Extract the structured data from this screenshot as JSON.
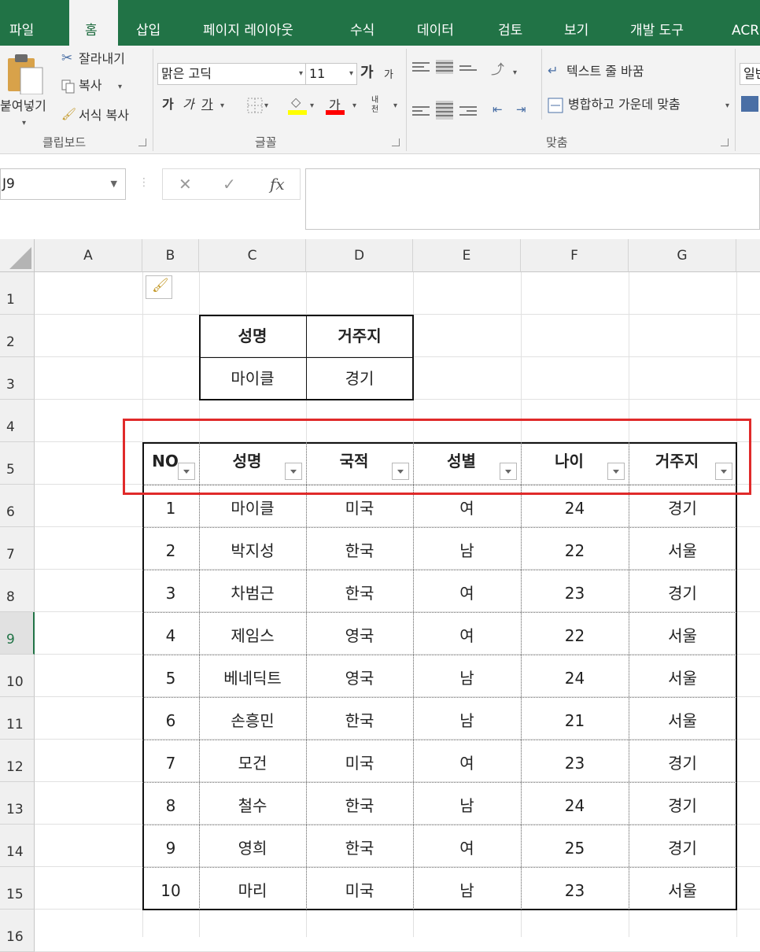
{
  "tabs": [
    "파일",
    "홈",
    "삽입",
    "페이지 레이아웃",
    "수식",
    "데이터",
    "검토",
    "보기",
    "개발 도구",
    "ACR"
  ],
  "active_tab": "홈",
  "clipboard": {
    "cut": "잘라내기",
    "copy": "복사",
    "paste": "붙여넣기",
    "format_painter": "서식 복사",
    "group": "클립보드"
  },
  "font": {
    "name": "맑은 고딕",
    "size": "11",
    "grow": "가",
    "shrink": "가",
    "bold": "가",
    "italic": "가",
    "underline": "가",
    "color_letter": "가",
    "phonetic": "내천",
    "group": "글꼴"
  },
  "alignment": {
    "wrap_text": "텍스트 줄 바꿈",
    "merge_center": "병합하고 가운데 맞춤",
    "group": "맞춤"
  },
  "number_format": "일반",
  "formula_bar": {
    "name_box": "J9",
    "cancel": "✕",
    "enter": "✓",
    "fx": "fx",
    "value": ""
  },
  "columns": [
    "A",
    "B",
    "C",
    "D",
    "E",
    "F",
    "G"
  ],
  "rows": [
    "1",
    "2",
    "3",
    "4",
    "5",
    "6",
    "7",
    "8",
    "9",
    "10",
    "11",
    "12",
    "13",
    "14",
    "15",
    "16"
  ],
  "active_row": "9",
  "criteria": {
    "headers": [
      "성명",
      "거주지"
    ],
    "values": [
      "마이클",
      "경기"
    ]
  },
  "table": {
    "headers": [
      "NO",
      "성명",
      "국적",
      "성별",
      "나이",
      "거주지"
    ],
    "rows": [
      [
        "1",
        "마이클",
        "미국",
        "여",
        "24",
        "경기"
      ],
      [
        "2",
        "박지성",
        "한국",
        "남",
        "22",
        "서울"
      ],
      [
        "3",
        "차범근",
        "한국",
        "여",
        "23",
        "경기"
      ],
      [
        "4",
        "제임스",
        "영국",
        "여",
        "22",
        "서울"
      ],
      [
        "5",
        "베네딕트",
        "영국",
        "남",
        "24",
        "서울"
      ],
      [
        "6",
        "손흥민",
        "한국",
        "남",
        "21",
        "서울"
      ],
      [
        "7",
        "모건",
        "미국",
        "여",
        "23",
        "경기"
      ],
      [
        "8",
        "철수",
        "한국",
        "남",
        "24",
        "경기"
      ],
      [
        "9",
        "영희",
        "한국",
        "여",
        "25",
        "경기"
      ],
      [
        "10",
        "마리",
        "미국",
        "남",
        "23",
        "서울"
      ]
    ]
  },
  "colors": {
    "ribbon_green": "#217346",
    "highlight_red": "#e02a2a",
    "fill_yellow": "#ffff00",
    "font_red": "#ff0000"
  }
}
